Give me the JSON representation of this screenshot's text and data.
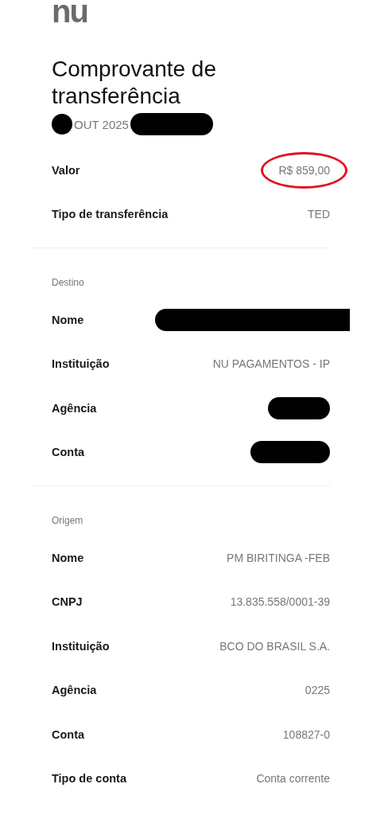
{
  "logo": {
    "text": "nu"
  },
  "title": "Comprovante de transferência",
  "date": [
    {
      "kind": "redacted"
    },
    {
      "kind": "text",
      "text": "OUT 2025"
    },
    {
      "kind": "redacted"
    }
  ],
  "sections": [
    {
      "rows": [
        {
          "label": "Valor",
          "kind": "text",
          "value": "R$ 859,00",
          "highlighted": true
        },
        {
          "label": "Tipo de transferência",
          "kind": "text",
          "value": "TED",
          "highlighted": false
        }
      ]
    },
    {
      "heading": "Destino",
      "rows": [
        {
          "label": "Nome",
          "kind": "redacted",
          "highlighted": false
        },
        {
          "label": "Instituição",
          "kind": "text",
          "value": "NU PAGAMENTOS - IP",
          "highlighted": false
        },
        {
          "label": "Agência",
          "kind": "redacted",
          "highlighted": false
        },
        {
          "label": "Conta",
          "kind": "redacted",
          "highlighted": false
        }
      ]
    },
    {
      "heading": "Origem",
      "rows": [
        {
          "label": "Nome",
          "kind": "text",
          "value": "PM BIRITINGA -FEB",
          "highlighted": false
        },
        {
          "label": "CNPJ",
          "kind": "text",
          "value": "13.835.558/0001-39",
          "highlighted": false
        },
        {
          "label": "Instituição",
          "kind": "text",
          "value": "BCO DO BRASIL S.A.",
          "highlighted": false
        },
        {
          "label": "Agência",
          "kind": "text",
          "value": "0225",
          "highlighted": false
        },
        {
          "label": "Conta",
          "kind": "text",
          "value": "108827-0",
          "highlighted": false
        },
        {
          "label": "Tipo de conta",
          "kind": "text",
          "value": "Conta corrente",
          "highlighted": false
        }
      ]
    }
  ]
}
